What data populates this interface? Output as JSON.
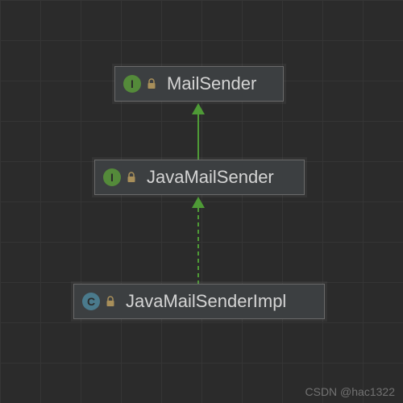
{
  "chart_data": {
    "type": "diagram",
    "title": "",
    "nodes": [
      {
        "id": "mail-sender",
        "kind": "interface",
        "label": "MailSender"
      },
      {
        "id": "java-mail-sender",
        "kind": "interface",
        "label": "JavaMailSender"
      },
      {
        "id": "java-mail-sender-impl",
        "kind": "class",
        "label": "JavaMailSenderImpl"
      }
    ],
    "edges": [
      {
        "from": "java-mail-sender",
        "to": "mail-sender",
        "style": "solid",
        "relation": "extends"
      },
      {
        "from": "java-mail-sender-impl",
        "to": "java-mail-sender",
        "style": "dashed",
        "relation": "implements"
      }
    ]
  },
  "nodes": {
    "mail_sender": {
      "label": "MailSender",
      "type_letter": "I"
    },
    "java_mail_sender": {
      "label": "JavaMailSender",
      "type_letter": "I"
    },
    "java_mail_sender_impl": {
      "label": "JavaMailSenderImpl",
      "type_letter": "C"
    }
  },
  "colors": {
    "background": "#2b2b2b",
    "grid": "#353535",
    "node_fill": "#3c3f41",
    "node_border": "#6a6a6a",
    "text": "#d4d4d4",
    "interface_badge": "#548a3a",
    "class_badge": "#4a7a8c",
    "arrow": "#4e9a36",
    "lock": "#a88f5a"
  },
  "watermark": "CSDN @hac1322"
}
